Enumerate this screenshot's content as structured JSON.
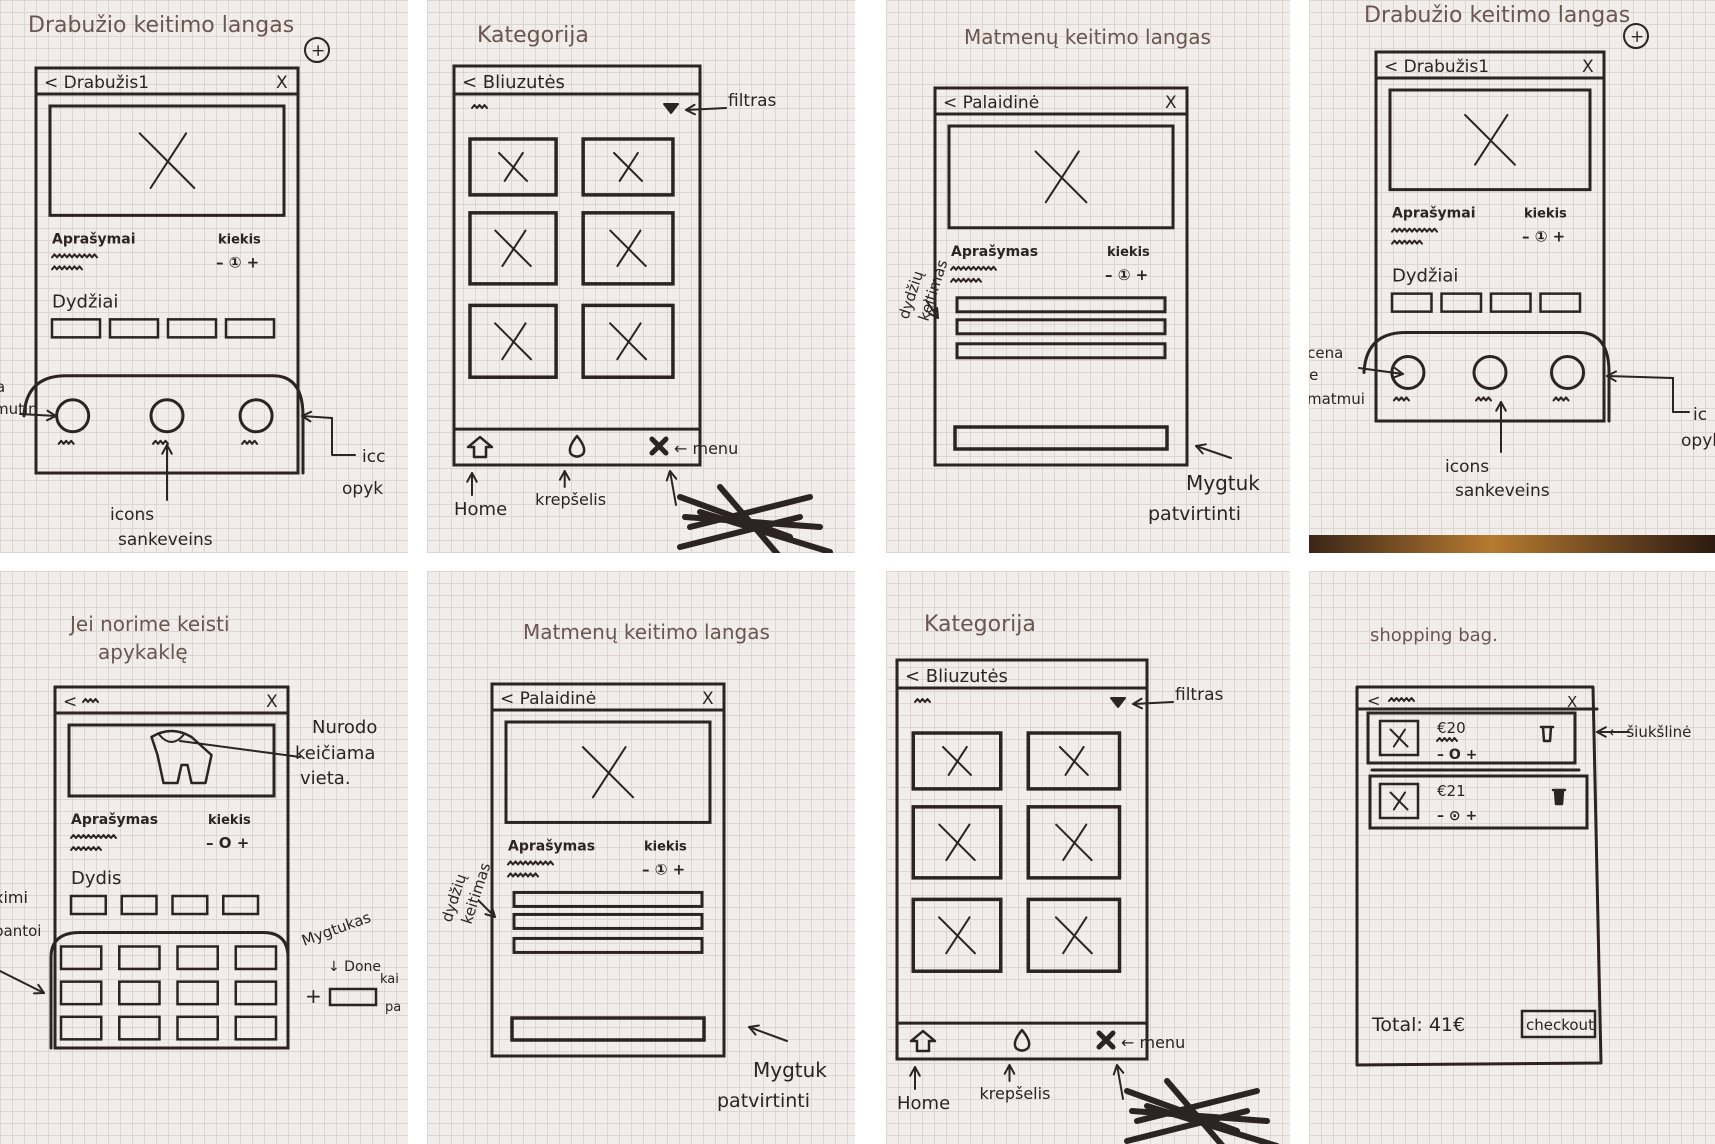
{
  "colors": {
    "paper": "#f1edeb",
    "grid": "#dcd5d2",
    "ink": "#2b2422",
    "title_ink": "#6b5650"
  },
  "panels": [
    {
      "title": "Drabužio keitimo langas",
      "title_badge": "+",
      "header_back": "< Drabužis1",
      "header_close": "X",
      "description_label": "Aprašymai",
      "quantity_label": "kiekis",
      "quantity_stepper": "– ① +",
      "sizes_label": "Dydžiai",
      "annotations": {
        "left": [
          "a",
          "mutin"
        ],
        "right": [
          "icc",
          "opyk"
        ],
        "bottom": [
          "icons",
          "sankeveins"
        ]
      }
    },
    {
      "title": "Kategorija",
      "header_back": "< Bliuzutės",
      "annotations": {
        "filter": "filtras",
        "menu": "← menu",
        "home": "Home",
        "cart": "krepšelis"
      }
    },
    {
      "title": "Matmenų keitimo langas",
      "header_back": "< Palaidinė",
      "header_close": "X",
      "description_label": "Aprašymas",
      "quantity_label": "kiekis",
      "quantity_stepper": "– ① +",
      "annotations": {
        "left": [
          "dydžių",
          "keitimas"
        ],
        "right": [
          "Mygtuk",
          "patvirtinti"
        ]
      }
    },
    {
      "title": "Drabužio keitimo langas",
      "title_badge": "+",
      "header_back": "< Drabužis1",
      "header_close": "X",
      "description_label": "Aprašymai",
      "quantity_label": "kiekis",
      "quantity_stepper": "– ① +",
      "sizes_label": "Dydžiai",
      "annotations": {
        "left": [
          "icena",
          "ie",
          "matmui"
        ],
        "right": [
          "ic",
          "opyl"
        ],
        "bottom": [
          "icons",
          "sankeveins"
        ]
      }
    },
    {
      "title": [
        "Jei norime keisti",
        "apykaklę"
      ],
      "header_back": "<",
      "header_close": "X",
      "description_label": "Aprašymas",
      "quantity_label": "kiekis",
      "quantity_stepper": "– O +",
      "sizes_label": "Dydis",
      "annotations": {
        "right_top": [
          "Nurodo",
          "keičiama",
          "vieta."
        ],
        "left": [
          "ximi",
          "pantoi"
        ],
        "right": [
          "Mygtukas",
          "↓ Done",
          "kai",
          "pa"
        ],
        "plus": "+"
      }
    },
    {
      "title": "Matmenų keitimo langas",
      "header_back": "< Palaidinė",
      "header_close": "X",
      "description_label": "Aprašymas",
      "quantity_label": "kiekis",
      "quantity_stepper": "– ① +",
      "annotations": {
        "left": [
          "dydžių",
          "keitimas"
        ],
        "right": [
          "Mygtuk",
          "patvirtinti"
        ]
      }
    },
    {
      "title": "Kategorija",
      "header_back": "< Bliuzutės",
      "annotations": {
        "filter": "filtras",
        "menu": "← menu",
        "home": "Home",
        "cart": "krepšelis"
      }
    },
    {
      "title": "shopping bag.",
      "header_back": "<",
      "header_close": "X",
      "items": [
        {
          "price": "€20",
          "stepper": "– O +"
        },
        {
          "price": "€21",
          "stepper": "– ⊙ +"
        }
      ],
      "trash_annotation": "← šiukšlinė",
      "total": "Total: 41€",
      "checkout": "checkout"
    }
  ]
}
